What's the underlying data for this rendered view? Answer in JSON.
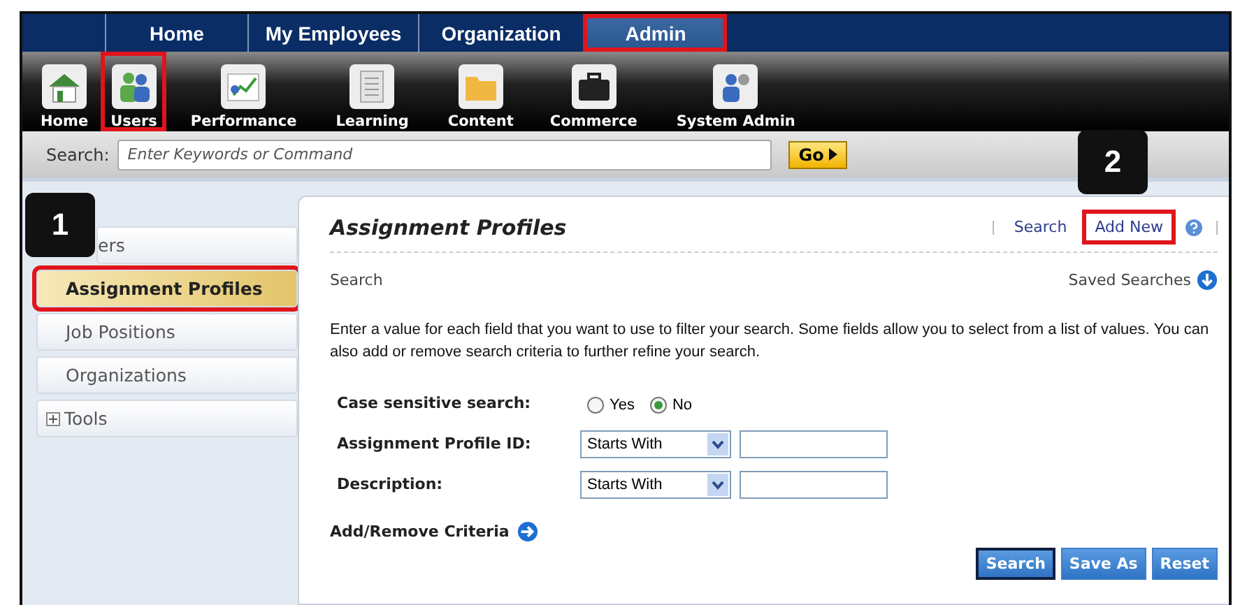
{
  "top_nav": {
    "tabs": [
      {
        "label": "Home",
        "selected": false,
        "highlighted": false
      },
      {
        "label": "My Employees",
        "selected": false,
        "highlighted": false
      },
      {
        "label": "Organization",
        "selected": false,
        "highlighted": false
      },
      {
        "label": "Admin",
        "selected": true,
        "highlighted": true
      }
    ]
  },
  "toolbar": {
    "items": [
      {
        "label": "Home",
        "kind": "house",
        "highlighted": false
      },
      {
        "label": "Users",
        "kind": "users",
        "highlighted": true
      },
      {
        "label": "Performance",
        "kind": "chart",
        "highlighted": false
      },
      {
        "label": "Learning",
        "kind": "document",
        "highlighted": false
      },
      {
        "label": "Content",
        "kind": "folder",
        "highlighted": false
      },
      {
        "label": "Commerce",
        "kind": "briefcase",
        "highlighted": false
      },
      {
        "label": "System Admin",
        "kind": "admin",
        "highlighted": false
      }
    ]
  },
  "search_bar": {
    "label": "Search:",
    "placeholder": "Enter Keywords or Command",
    "button": "Go"
  },
  "sidebar": {
    "callout": "1",
    "items": [
      {
        "label": "ers",
        "kind": "link",
        "selected": false,
        "highlighted": false
      },
      {
        "label": "Assignment Profiles",
        "kind": "link",
        "selected": true,
        "highlighted": true
      },
      {
        "label": "Job Positions",
        "kind": "link",
        "selected": false,
        "highlighted": false
      },
      {
        "label": "Organizations",
        "kind": "link",
        "selected": false,
        "highlighted": false
      },
      {
        "label": "Tools",
        "kind": "group",
        "expanded": false
      }
    ]
  },
  "panel": {
    "title": "Assignment Profiles",
    "callout": "2",
    "links": [
      {
        "label": "Search",
        "highlighted": false
      },
      {
        "label": "Add New",
        "highlighted": true
      }
    ],
    "section": "Search",
    "saved_searches": "Saved Searches",
    "instructions": "Enter a value for each field that you want to use to filter your search. Some fields allow you to select from a list of values. You can also add or remove search criteria to further refine your search.",
    "fields": [
      {
        "kind": "radio",
        "label": "Case sensitive search:",
        "options": [
          {
            "label": "Yes",
            "selected": false
          },
          {
            "label": "No",
            "selected": true
          }
        ]
      },
      {
        "kind": "text",
        "label": "Assignment Profile ID:",
        "operator": "Starts With"
      },
      {
        "kind": "text",
        "label": "Description:",
        "operator": "Starts With"
      }
    ],
    "criteria_link": "Add/Remove Criteria",
    "buttons": [
      {
        "label": "Search",
        "focused": true
      },
      {
        "label": "Save As",
        "focused": false
      },
      {
        "label": "Reset",
        "focused": false
      }
    ]
  }
}
